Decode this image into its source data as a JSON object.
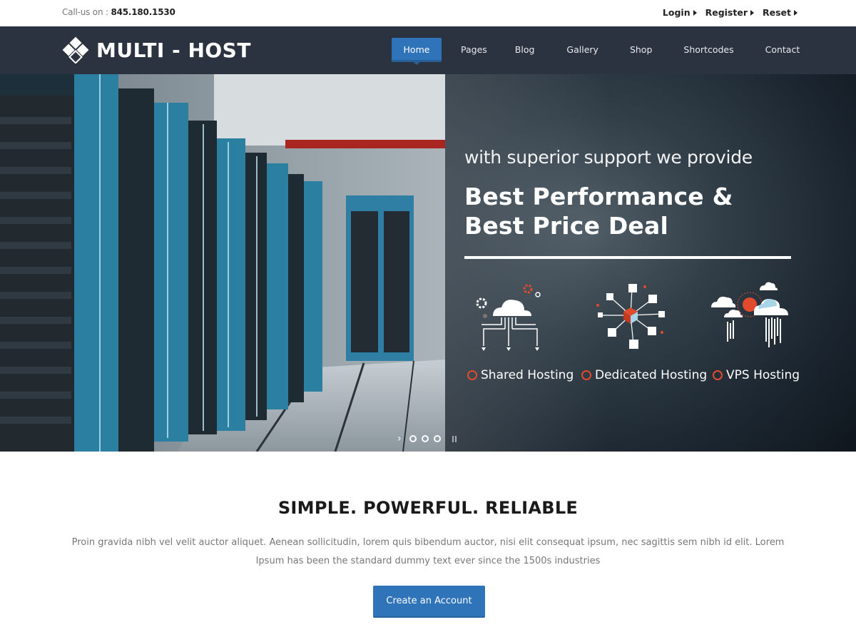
{
  "topbar": {
    "call_label": "Call-us on :",
    "phone": "845.180.1530",
    "login": "Login",
    "register": "Register",
    "reset": "Reset"
  },
  "brand": {
    "name": "MULTI - HOST",
    "logo_icon": "diamond-grid-icon"
  },
  "nav": {
    "items": [
      {
        "label": "Home",
        "active": true
      },
      {
        "label": "Pages"
      },
      {
        "label": "Blog"
      },
      {
        "label": "Gallery"
      },
      {
        "label": "Shop"
      },
      {
        "label": "Shortcodes"
      },
      {
        "label": "Contact"
      }
    ]
  },
  "hero": {
    "subtitle": "with superior support we provide",
    "title": "Best Performance & Best Price Deal",
    "services": [
      {
        "label": "Shared Hosting",
        "icon": "cloud-network-icon"
      },
      {
        "label": "Dedicated Hosting",
        "icon": "server-cube-network-icon"
      },
      {
        "label": "VPS Hosting",
        "icon": "cloud-data-icon"
      }
    ],
    "slider": {
      "slides": 3,
      "active": 1
    }
  },
  "intro": {
    "heading": "SIMPLE. POWERFUL. RELIABLE",
    "text": "Proin gravida nibh vel velit auctor aliquet. Aenean sollicitudin, lorem quis bibendum auctor, nisi elit consequat ipsum, nec sagittis sem nibh id elit. Lorem Ipsum has been the  standard dummy text ever since the 1500s industries",
    "cta": "Create an Account"
  },
  "colors": {
    "nav_bg": "#2c3340",
    "accent": "#2f73b8",
    "highlight": "#e24a2d"
  }
}
